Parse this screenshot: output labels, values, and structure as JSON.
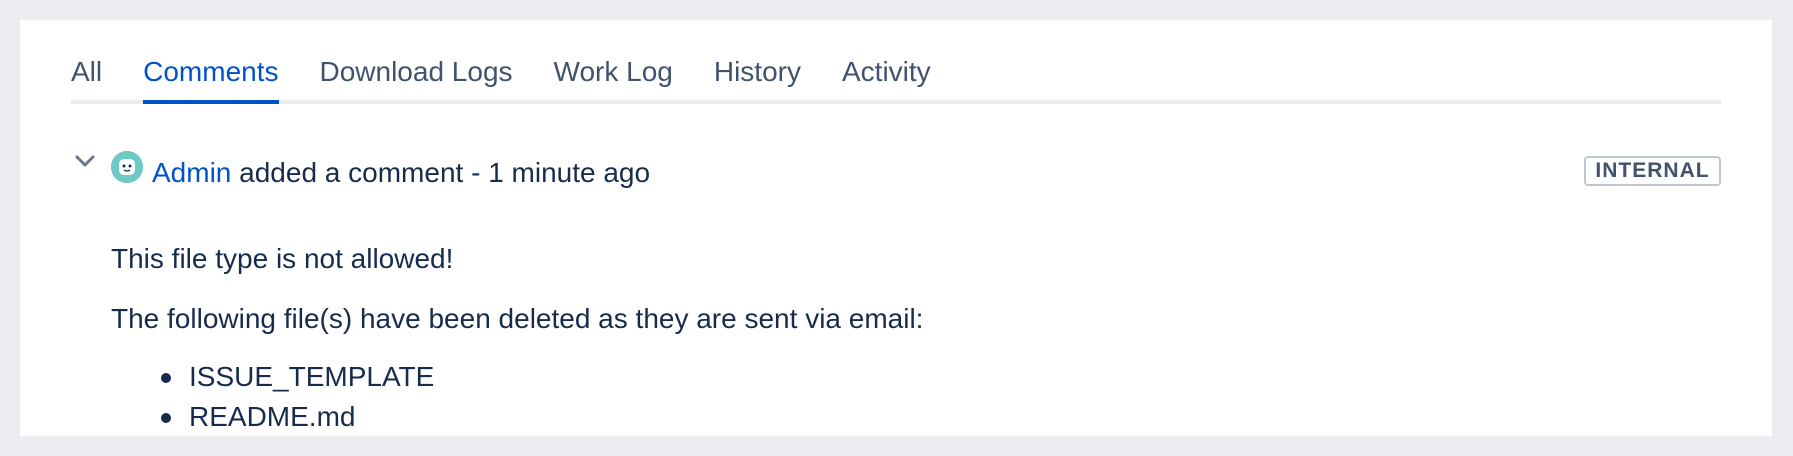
{
  "tabs": [
    {
      "label": "All",
      "active": false
    },
    {
      "label": "Comments",
      "active": true
    },
    {
      "label": "Download Logs",
      "active": false
    },
    {
      "label": "Work Log",
      "active": false
    },
    {
      "label": "History",
      "active": false
    },
    {
      "label": "Activity",
      "active": false
    }
  ],
  "comment": {
    "author": "Admin",
    "action": "added a comment",
    "separator": "-",
    "time": "1 minute ago",
    "badge": "INTERNAL",
    "avatar_color": "#6cc9c5",
    "body": {
      "line1": "This file type is not allowed!",
      "line2": "The following file(s) have been deleted as they are sent via email:",
      "files": [
        "ISSUE_TEMPLATE",
        "README.md"
      ]
    }
  },
  "colors": {
    "background": "#ebecf0",
    "link": "#0052cc",
    "text": "#172b4d",
    "muted": "#42526e"
  },
  "icons": {
    "toggle": "chevron-down-icon",
    "avatar": "user-avatar-icon"
  }
}
